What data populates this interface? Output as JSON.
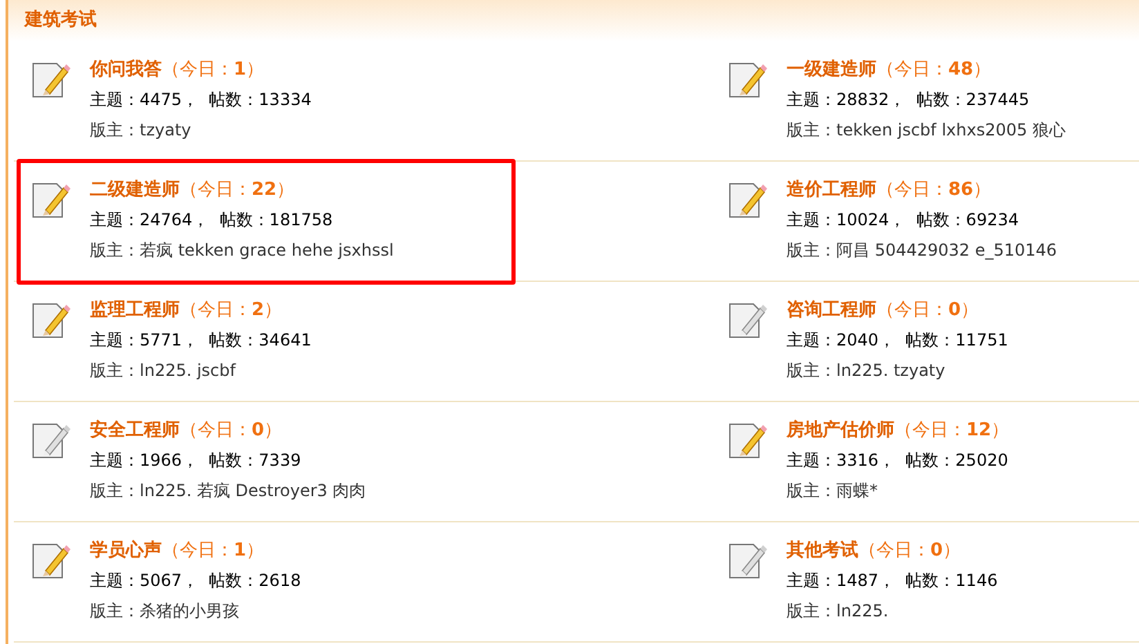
{
  "section": {
    "title": "建筑考试"
  },
  "forums": [
    {
      "name": "你问我答",
      "today": "（今日：**1**）",
      "stats": "主题：4475，  帖数：13334",
      "moderators": "版主：tzyaty",
      "new": true,
      "highlighted": false
    },
    {
      "name": "一级建造师",
      "today": "（今日：**48**）",
      "stats": "主题：28832，  帖数：237445",
      "moderators": "版主：tekken jscbf lxhxs2005 狼心",
      "new": true,
      "highlighted": false
    },
    {
      "name": "二级建造师",
      "today": "（今日：**22**）",
      "stats": "主题：24764，  帖数：181758",
      "moderators": "版主：若疯 tekken grace hehe jsxhssl",
      "new": true,
      "highlighted": true
    },
    {
      "name": "造价工程师",
      "today": "（今日：**86**）",
      "stats": "主题：10024，  帖数：69234",
      "moderators": "版主：阿昌 504429032 e_510146",
      "new": true,
      "highlighted": false
    },
    {
      "name": "监理工程师",
      "today": "（今日：**2**）",
      "stats": "主题：5771，  帖数：34641",
      "moderators": "版主：ln225. jscbf",
      "new": true,
      "highlighted": false
    },
    {
      "name": "咨询工程师",
      "today": "（今日：**0**）",
      "stats": "主题：2040，  帖数：11751",
      "moderators": "版主：ln225. tzyaty",
      "new": false,
      "highlighted": false
    },
    {
      "name": "安全工程师",
      "today": "（今日：**0**）",
      "stats": "主题：1966，  帖数：7339",
      "moderators": "版主：ln225. 若疯 Destroyer3 肉肉",
      "new": false,
      "highlighted": false
    },
    {
      "name": "房地产估价师",
      "today": "（今日：**12**）",
      "stats": "主题：3316，  帖数：25020",
      "moderators": "版主：雨蝶*",
      "new": true,
      "highlighted": false
    },
    {
      "name": "学员心声",
      "today": "（今日：**1**）",
      "stats": "主题：5067，  帖数：2618",
      "moderators": "版主：杀猪的小男孩",
      "new": true,
      "highlighted": false
    },
    {
      "name": "其他考试",
      "today": "（今日：**0**）",
      "stats": "主题：1487，  帖数：1146",
      "moderators": "版主：ln225.",
      "new": false,
      "highlighted": false
    }
  ]
}
